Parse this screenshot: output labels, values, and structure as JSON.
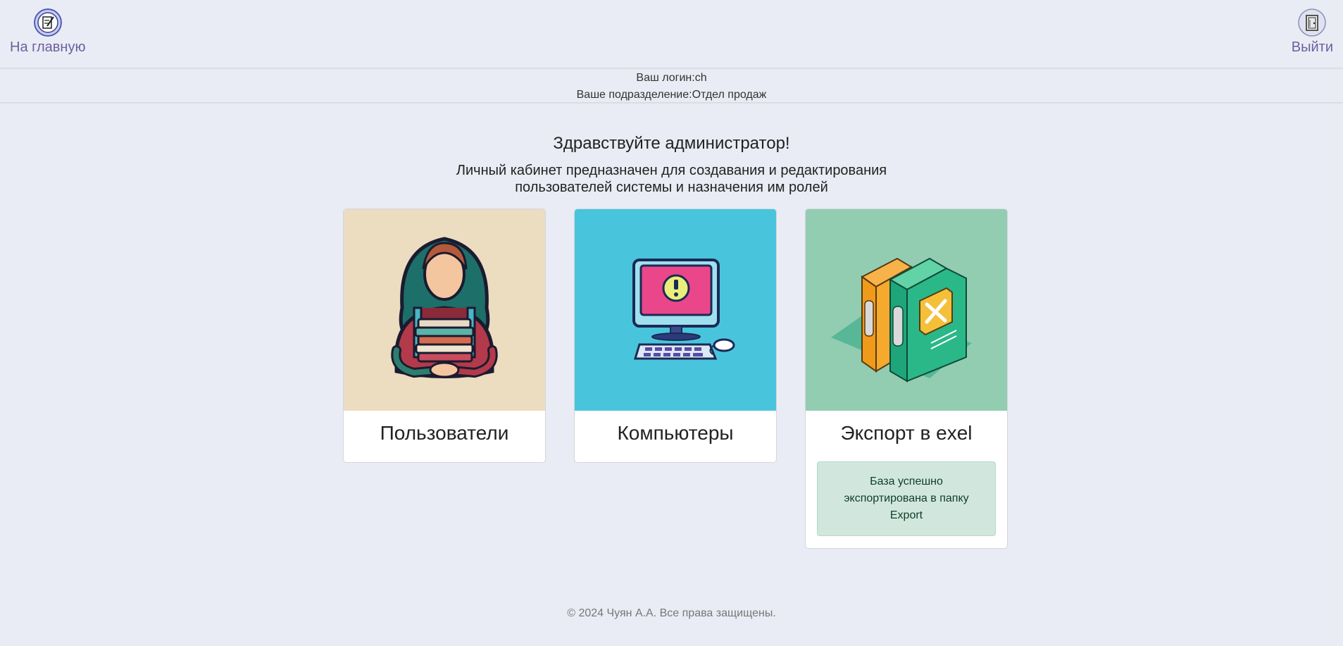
{
  "header": {
    "home_label": "На главную",
    "exit_label": "Выйти",
    "home_icon": "notepad-pencil-icon",
    "exit_icon": "door-exit-icon"
  },
  "userinfo": {
    "login": "Ваш логин:ch",
    "division": "Ваше подразделение:Отдел продаж"
  },
  "main": {
    "greeting": "Здравствуйте администратор!",
    "description": "Личный кабинет предназначен для создавания и редактирования пользователей системы и назначения им ролей"
  },
  "cards": [
    {
      "title": "Пользователи",
      "image": "woman-holding-books-illustration",
      "bg": "#ecdcc0"
    },
    {
      "title": "Компьютеры",
      "image": "computer-warning-illustration",
      "bg": "#48c5dc"
    },
    {
      "title": "Экспорт в exel",
      "image": "excel-binders-illustration",
      "bg": "#92cdb2"
    }
  ],
  "export_alert": "База успешно экспортирована в папку Export",
  "footer": "© 2024 Чуян А.А. Все права защищены."
}
